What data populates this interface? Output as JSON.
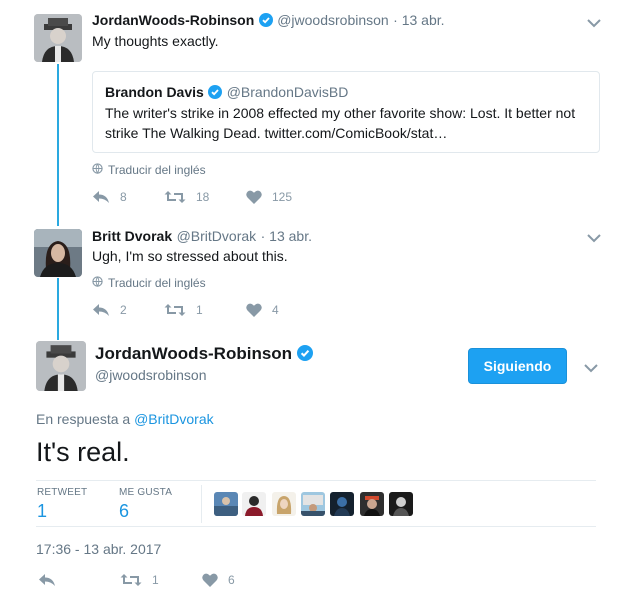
{
  "tweet1": {
    "name": "JordanWoods-Robinson",
    "handle": "@jwoodsrobinson",
    "date": "· 13 abr.",
    "text": "My thoughts exactly.",
    "quote": {
      "name": "Brandon Davis",
      "handle": "@BrandonDavisBD",
      "text_line1": "The writer's strike in 2008 effected my other favorite show: Lost. It better not",
      "text_line2": "strike The Walking Dead. twitter.com/ComicBook/stat…"
    },
    "translate": "Traducir del inglés",
    "replies": "8",
    "retweets": "18",
    "likes": "125"
  },
  "tweet2": {
    "name": "Britt Dvorak",
    "handle": "@BritDvorak",
    "date": "· 13 abr.",
    "text": "Ugh, I'm so stressed about this.",
    "translate": "Traducir del inglés",
    "replies": "2",
    "retweets": "1",
    "likes": "4"
  },
  "main": {
    "name": "JordanWoods-Robinson",
    "handle": "@jwoodsrobinson",
    "follow_label": "Siguiendo",
    "reply_prefix": "En respuesta a",
    "reply_to": "@BritDvorak",
    "text": "It's real.",
    "retweet_label": "RETWEET",
    "retweet_count": "1",
    "likes_label": "ME GUSTA",
    "likes_count": "6",
    "timestamp": "17:36 - 13 abr. 2017",
    "action_retweets": "1",
    "action_likes": "6"
  },
  "colors": {
    "accent": "#1da1f2",
    "link": "#1b95e0",
    "thread": "#2aa9e0",
    "muted": "#657786"
  },
  "icons": [
    "verified-icon",
    "chevron-down-icon",
    "globe-icon",
    "reply-icon",
    "retweet-icon",
    "heart-icon"
  ]
}
